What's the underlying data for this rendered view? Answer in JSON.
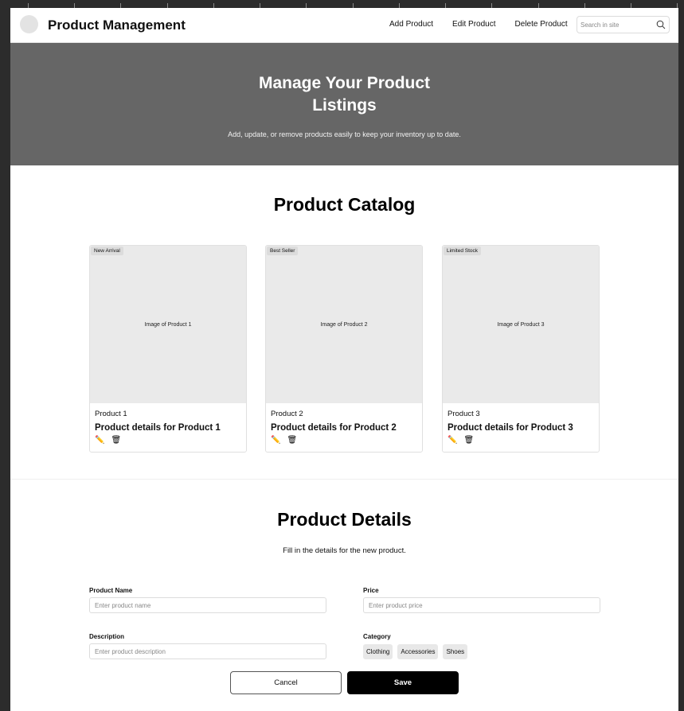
{
  "header": {
    "title": "Product Management",
    "nav": [
      "Add Product",
      "Edit Product",
      "Delete Product"
    ],
    "search_placeholder": "Search in site"
  },
  "hero": {
    "title": "Manage Your Product Listings",
    "subtitle": "Add, update, or remove products easily to keep your inventory up to date."
  },
  "catalog": {
    "title": "Product Catalog",
    "products": [
      {
        "badge": "New Arrival",
        "image_label": "Image of Product 1",
        "name": "Product 1",
        "details": "Product details for Product 1"
      },
      {
        "badge": "Best Seller",
        "image_label": "Image of Product 2",
        "name": "Product 2",
        "details": "Product details for Product 2"
      },
      {
        "badge": "Limited Stock",
        "image_label": "Image of Product 3",
        "name": "Product 3",
        "details": "Product details for Product 3"
      }
    ],
    "edit_icon": "✏️",
    "delete_icon": "🗑"
  },
  "details": {
    "title": "Product Details",
    "subtitle": "Fill in the details for the new product.",
    "name_label": "Product Name",
    "name_placeholder": "Enter product name",
    "price_label": "Price",
    "price_placeholder": "Enter product price",
    "description_label": "Description",
    "description_placeholder": "Enter product description",
    "category_label": "Category",
    "categories": [
      "Clothing",
      "Accessories",
      "Shoes"
    ],
    "cancel_label": "Cancel",
    "save_label": "Save"
  }
}
